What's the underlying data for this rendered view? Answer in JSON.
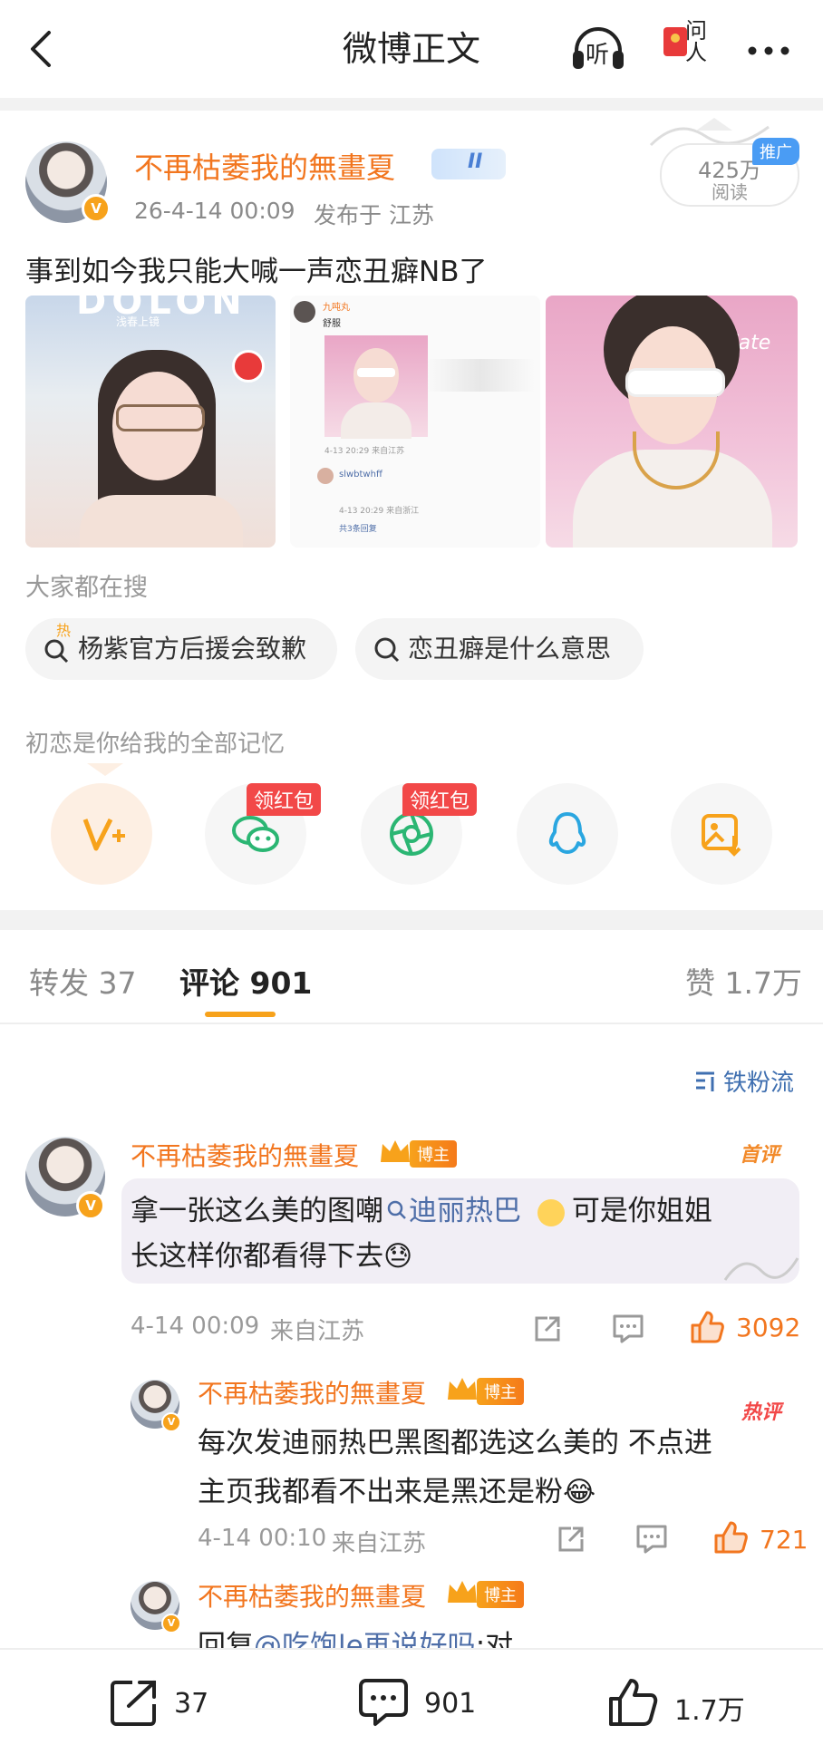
{
  "header": {
    "title": "微博正文",
    "listen_label": "听",
    "ask_label": "问人"
  },
  "post": {
    "author": "不再枯萎我的無畫夏",
    "level_badge": "II",
    "time": "26-4-14 00:09",
    "published_from": "发布于 江苏",
    "reads": "425万",
    "reads_label": "阅读",
    "ad_tag": "推广",
    "text": "事到如今我只能大喊一声恋丑癖NB了",
    "image1_brand": "DOLON",
    "image1_sub": "浅春上镜",
    "image2": {
      "user1": "九吨丸",
      "user1_text": "舒服",
      "date1": "4-13 20:29 来自江苏",
      "user2": "slwbtwhff",
      "date2": "4-13 20:29 来自浙江",
      "replies": "共3条回复"
    },
    "image3_sign": "Fate"
  },
  "search": {
    "label": "大家都在搜",
    "chips": [
      {
        "text": "杨紫官方后援会致歉",
        "icon": "hot-search-icon",
        "badge": "热"
      },
      {
        "text": "恋丑癖是什么意思",
        "icon": "search-icon"
      }
    ]
  },
  "share": {
    "label": "初恋是你给我的全部记忆",
    "items": [
      {
        "name": "weibo-repost-icon"
      },
      {
        "name": "wechat-icon",
        "tag": "领红包"
      },
      {
        "name": "moments-icon",
        "tag": "领红包"
      },
      {
        "name": "qq-icon"
      },
      {
        "name": "save-image-icon"
      }
    ]
  },
  "tabs": {
    "repost": "转发 37",
    "comments": "评论 901",
    "likes": "赞 1.7万"
  },
  "sort_label": "铁粉流",
  "comments": [
    {
      "author": "不再枯萎我的無畫夏",
      "badge": "博主",
      "tag": "首评",
      "line1_a": "拿一张这么美的图嘲",
      "link": "迪丽热巴",
      "line1_b": "可是你姐姐",
      "line2": "长这样你都看得下去😓",
      "date": "4-14 00:09",
      "from": "来自江苏",
      "likes": "3092"
    },
    {
      "author": "不再枯萎我的無畫夏",
      "badge": "博主",
      "tag": "热评",
      "line1": "每次发迪丽热巴黑图都选这么美的 不点进",
      "line2": "主页我都看不出来是黑还是粉😂",
      "date": "4-14 00:10",
      "from": "来自江苏",
      "likes": "721"
    },
    {
      "author": "不再枯萎我的無畫夏",
      "badge": "博主",
      "reply_prefix": "回复",
      "reply_mention": "@吃饱le再说好吗",
      "reply_suffix": ":对"
    }
  ],
  "bottom_bar": {
    "repost": "37",
    "comment": "901",
    "like": "1.7万"
  },
  "colors": {
    "accent_orange": "#f7a21b",
    "name_orange": "#f2761f",
    "link_blue": "#4e6ea8",
    "red": "#f24848"
  }
}
